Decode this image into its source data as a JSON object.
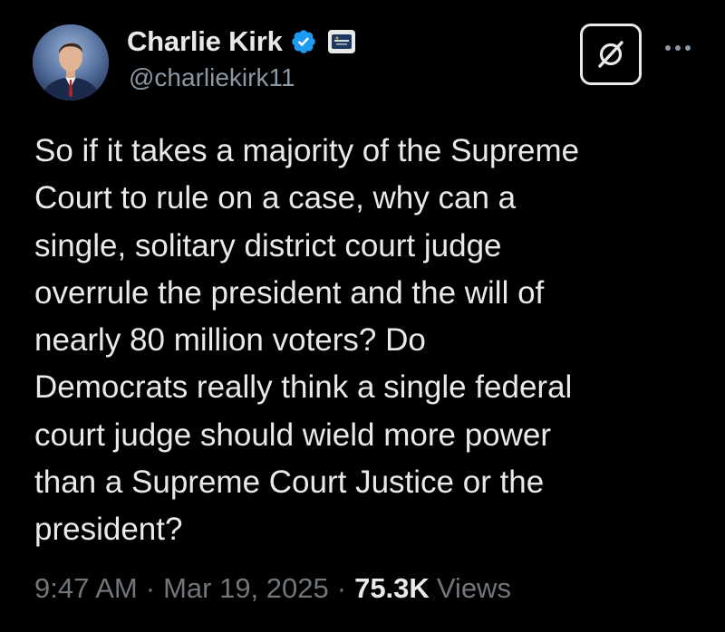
{
  "author": {
    "display_name": "Charlie Kirk",
    "handle": "@charliekirk11",
    "verified": true,
    "verified_color": "#1d9bf0",
    "affiliate_badge": "organization-badge-icon"
  },
  "actions": {
    "grok_icon": "grok-icon",
    "more_icon": "more-options-icon"
  },
  "tweet": {
    "text_lines": [
      "So if it takes a majority of the Supreme",
      "Court to rule on a case, why can a",
      "single, solitary district court judge",
      "overrule the president and the will of",
      "nearly 80 million voters? Do",
      "Democrats really think a single federal",
      "court judge should wield more power",
      "than a Supreme Court Justice or the",
      "president?"
    ]
  },
  "meta": {
    "time": "9:47 AM",
    "separator": "·",
    "date": "Mar 19, 2025",
    "views_count": "75.3K",
    "views_label": "Views"
  },
  "colors": {
    "background": "#000000",
    "text_primary": "#e7e9ea",
    "text_secondary": "#71767b",
    "handle": "#8b98a5"
  }
}
